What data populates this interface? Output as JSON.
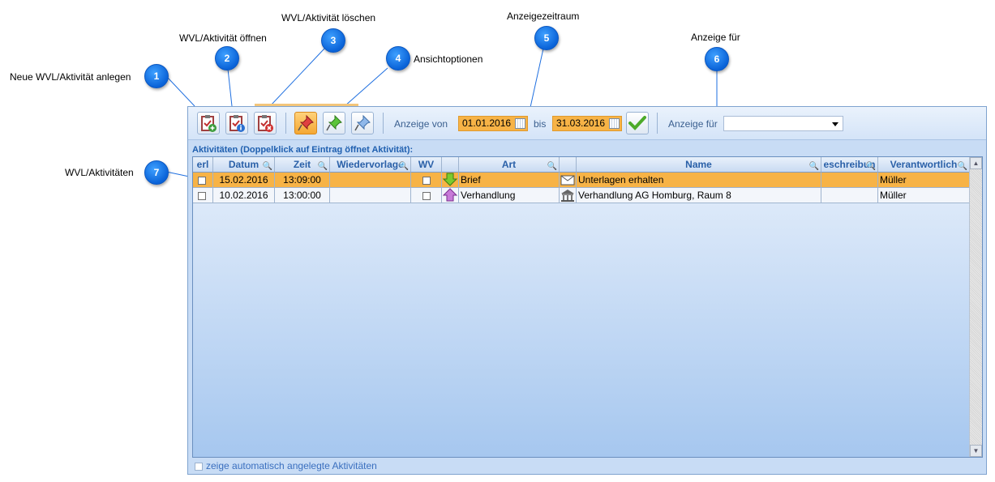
{
  "callouts": [
    {
      "num": "1",
      "label": "Neue WVL/Aktivität anlegen"
    },
    {
      "num": "2",
      "label": "WVL/Aktivität öffnen"
    },
    {
      "num": "3",
      "label": "WVL/Aktivität löschen"
    },
    {
      "num": "4",
      "label": "Ansichtoptionen"
    },
    {
      "num": "5",
      "label": "Anzeigezeitraum"
    },
    {
      "num": "6",
      "label": "Anzeige für"
    },
    {
      "num": "7",
      "label": "WVL/Aktivitäten"
    }
  ],
  "toolbar": {
    "icons": [
      "new-activity-icon",
      "open-activity-icon",
      "delete-activity-icon",
      "pin-red-icon",
      "pin-green-icon",
      "pin-blue-icon",
      "checkmark-icon",
      "calendar-icon"
    ],
    "anzeige_von_label": "Anzeige von",
    "date_from": "01.01.2016",
    "bis_label": "bis",
    "date_to": "31.03.2016",
    "anzeige_fuer_label": "Anzeige für",
    "anzeige_fuer_value": ""
  },
  "grid": {
    "title": "Aktivitäten (Doppelklick auf Eintrag öffnet Aktivität):",
    "columns": [
      "erl",
      "Datum",
      "Zeit",
      "Wiedervorlage",
      "WV",
      "",
      "Art",
      "",
      "Name",
      "eschreibun",
      "Verantwortlich"
    ],
    "rows": [
      {
        "datum": "15.02.2016",
        "zeit": "13:09:00",
        "wiedervorlage": "",
        "art": "Brief",
        "art_icon": "arrow-down-green-icon",
        "name": "Unterlagen erhalten",
        "name_icon": "envelope-icon",
        "beschreibung": "",
        "verantwortlich": "Müller",
        "selected": true
      },
      {
        "datum": "10.02.2016",
        "zeit": "13:00:00",
        "wiedervorlage": "",
        "art": "Verhandlung",
        "art_icon": "arrow-up-purple-icon",
        "name": "Verhandlung AG Homburg, Raum 8",
        "name_icon": "courthouse-icon",
        "beschreibung": "",
        "verantwortlich": "Müller",
        "selected": false
      }
    ]
  },
  "footer": {
    "checkbox_label": "zeige automatisch angelegte Aktivitäten"
  },
  "colors": {
    "accent": "#f7b346",
    "badge": "#1a7ff0",
    "panel": "#c8dcf5"
  }
}
